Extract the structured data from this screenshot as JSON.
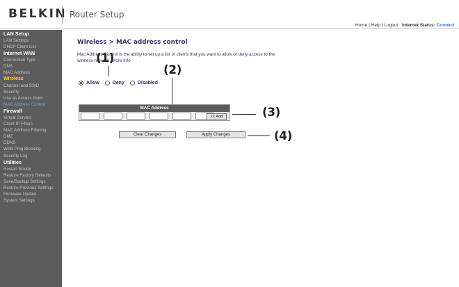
{
  "header": {
    "brand": "BELKIN",
    "app_title": "Router Setup",
    "links": [
      "Home",
      "Help",
      "Logout"
    ],
    "status_label": "Internet Status:",
    "status_value": "Connect"
  },
  "sidebar": {
    "sections": [
      {
        "title": "LAN Setup",
        "items": [
          {
            "label": "LAN Settings"
          },
          {
            "label": "DHCP Client List"
          }
        ]
      },
      {
        "title": "Internet WAN",
        "items": [
          {
            "label": "Connection Type"
          },
          {
            "label": "DNS"
          },
          {
            "label": "MAC Address"
          }
        ]
      },
      {
        "title": "Wireless",
        "category": true,
        "items": [
          {
            "label": "Channel and SSID"
          },
          {
            "label": "Security"
          },
          {
            "label": "Use as Access Point"
          },
          {
            "label": "MAC Address Control",
            "current": true
          }
        ]
      },
      {
        "title": "Firewall",
        "items": [
          {
            "label": "Virtual Servers"
          },
          {
            "label": "Client IP Filters"
          },
          {
            "label": "MAC Address Filtering"
          },
          {
            "label": "DMZ"
          },
          {
            "label": "DDNS"
          },
          {
            "label": "WAN Ping Blocking"
          },
          {
            "label": "Security Log"
          }
        ]
      },
      {
        "title": "Utilities",
        "items": [
          {
            "label": "Restart Router"
          },
          {
            "label": "Restore Factory Defaults"
          },
          {
            "label": "Save/Backup Settings"
          },
          {
            "label": "Restore Previous Settings"
          },
          {
            "label": "Firmware Update"
          },
          {
            "label": "System Settings"
          }
        ]
      }
    ]
  },
  "main": {
    "title": "Wireless > MAC address control",
    "description_line1": "Mac Address Control is the ability to set up a list of clients that you want to allow or deny access to the",
    "description_line2": "wireless network.",
    "more_info": "More Info",
    "radio_options": [
      "Allow",
      "Deny",
      "Disabled"
    ],
    "selected_option": "Allow",
    "table_header": "MAC Address",
    "add_button": "<< Add",
    "clear_button": "Clear Changes",
    "apply_button": "Apply Changes"
  },
  "callouts": [
    "(1)",
    "(2)",
    "(3)",
    "(4)"
  ],
  "colors": {
    "sidebar_bg": "#5c5c5c",
    "category": "#ffd400",
    "current_item": "#7fa3d9",
    "status": "#3366cc"
  }
}
